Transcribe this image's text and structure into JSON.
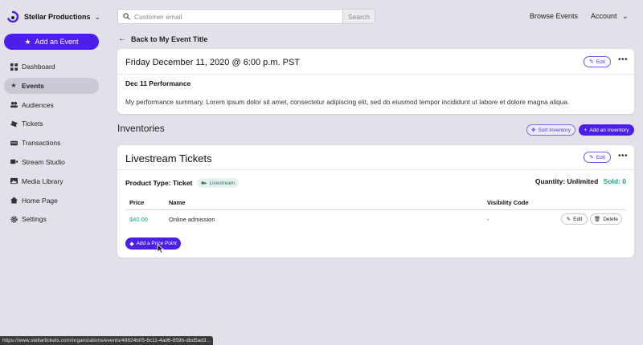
{
  "brand": {
    "name": "Stellar Productions",
    "caret": "⌄"
  },
  "sidebar": {
    "add_event_label": "Add an Event",
    "items": [
      {
        "label": "Dashboard",
        "icon": "dashboard-icon",
        "active": false
      },
      {
        "label": "Events",
        "icon": "star-icon",
        "active": true
      },
      {
        "label": "Audiences",
        "icon": "people-icon",
        "active": false
      },
      {
        "label": "Tickets",
        "icon": "ticket-icon",
        "active": false
      },
      {
        "label": "Transactions",
        "icon": "transactions-icon",
        "active": false
      },
      {
        "label": "Stream Studio",
        "icon": "video-icon",
        "active": false
      },
      {
        "label": "Media Library",
        "icon": "media-icon",
        "active": false
      },
      {
        "label": "Home Page",
        "icon": "home-icon",
        "active": false
      },
      {
        "label": "Settings",
        "icon": "gear-icon",
        "active": false
      }
    ]
  },
  "search": {
    "placeholder": "Customer email",
    "button_label": "Search"
  },
  "topnav": {
    "browse": "Browse Events",
    "account": "Account",
    "account_caret": "⌄"
  },
  "back_link": "Back to My Event Title",
  "event_card": {
    "title": "Friday December 11, 2020 @ 6:00 p.m. PST",
    "edit_label": "Edit",
    "subtitle": "Dec 11 Performance",
    "summary": "My performance summary. Lorem ipsum dolor sit amet, consectetur adipiscing elit, sed do eiusmod tempor incididunt ut labore et dolore magna aliqua."
  },
  "inventories": {
    "heading": "Inventories",
    "sort_label": "Sort Inventory",
    "add_label": "Add an Inventory"
  },
  "inventory_card": {
    "title": "Livestream Tickets",
    "edit_label": "Edit",
    "product_type_label": "Product Type: Ticket",
    "product_badge": "Livestream",
    "quantity": "Quantity: Unlimited",
    "sold": "Sold: 0",
    "columns": {
      "price": "Price",
      "name": "Name",
      "visibility": "Visibility Code"
    },
    "rows": [
      {
        "price": "$40.00",
        "name": "Online admission",
        "visibility": "-"
      }
    ],
    "row_edit_label": "Edit",
    "row_delete_label": "Delete",
    "add_price_label": "Add a Price Point"
  },
  "status_url": "https://www.stellartickets.com/organizations/events/48824b05-6c11-4ad6-859b-dbd5ad3...",
  "colors": {
    "accent": "#4c1fe8",
    "success": "#1aa083",
    "background": "#e3e0e9"
  }
}
